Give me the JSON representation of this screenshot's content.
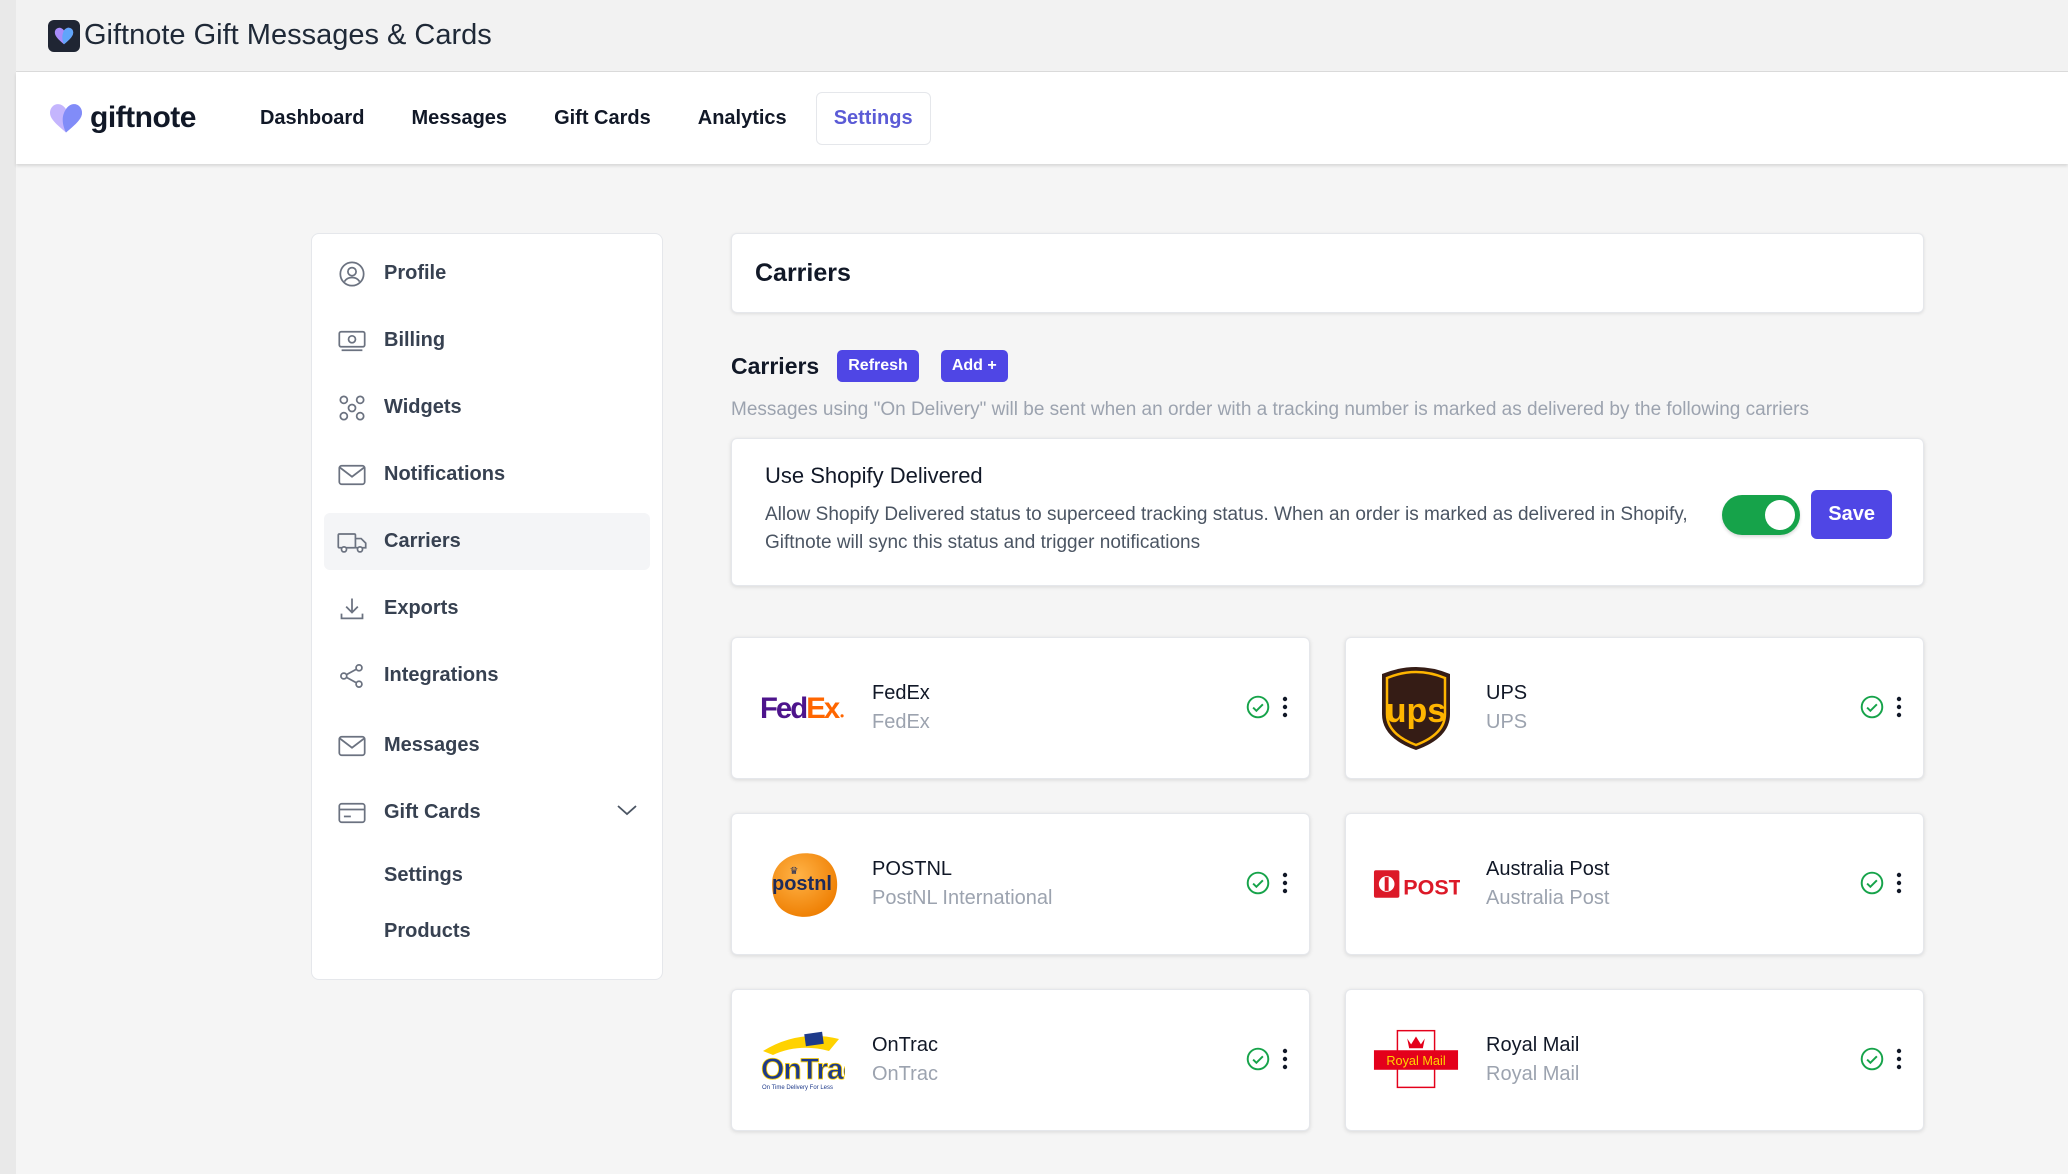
{
  "window": {
    "title": "Giftnote Gift Messages & Cards"
  },
  "brand": {
    "name": "giftnote",
    "accent": "#5b5bd6"
  },
  "nav": {
    "tabs": [
      {
        "label": "Dashboard"
      },
      {
        "label": "Messages"
      },
      {
        "label": "Gift Cards"
      },
      {
        "label": "Analytics"
      },
      {
        "label": "Settings",
        "active": true
      }
    ]
  },
  "sidebar": {
    "items": [
      {
        "label": "Profile",
        "icon": "user-circle-icon"
      },
      {
        "label": "Billing",
        "icon": "money-bill-icon"
      },
      {
        "label": "Widgets",
        "icon": "widgets-icon"
      },
      {
        "label": "Notifications",
        "icon": "envelope-icon"
      },
      {
        "label": "Carriers",
        "icon": "truck-icon",
        "active": true
      },
      {
        "label": "Exports",
        "icon": "download-icon"
      },
      {
        "label": "Integrations",
        "icon": "share-icon"
      },
      {
        "label": "Messages",
        "icon": "envelope-icon"
      },
      {
        "label": "Gift Cards",
        "icon": "credit-card-icon",
        "expanded": true
      }
    ],
    "gift_cards_sub": [
      {
        "label": "Settings"
      },
      {
        "label": "Products"
      }
    ]
  },
  "main": {
    "header_title": "Carriers",
    "section_title": "Carriers",
    "refresh_label": "Refresh",
    "add_label": "Add +",
    "description": "Messages using \"On Delivery\" will be sent when an order with a tracking number is marked as delivered by the following carriers",
    "shopify": {
      "title": "Use Shopify Delivered",
      "description": "Allow Shopify Delivered status to superceed tracking status. When an order is marked as delivered in Shopify, Giftnote will sync this status and trigger notifications",
      "enabled": true,
      "save_label": "Save"
    },
    "carriers": [
      {
        "name": "FedEx",
        "sub": "FedEx",
        "logo": "fedex-logo",
        "logo_text": "FedEx",
        "active": true
      },
      {
        "name": "UPS",
        "sub": "UPS",
        "logo": "ups-logo",
        "logo_text": "ups",
        "active": true
      },
      {
        "name": "POSTNL",
        "sub": "PostNL International",
        "logo": "postnl-logo",
        "logo_text": "postnl",
        "active": true
      },
      {
        "name": "Australia Post",
        "sub": "Australia Post",
        "logo": "australia-post-logo",
        "logo_text": "POST",
        "active": true
      },
      {
        "name": "OnTrac",
        "sub": "OnTrac",
        "logo": "ontrac-logo",
        "logo_text": "OnTrac",
        "logo_tagline": "On Time Delivery For Less",
        "active": true
      },
      {
        "name": "Royal Mail",
        "sub": "Royal Mail",
        "logo": "royal-mail-logo",
        "logo_text": "Royal Mail",
        "active": true
      }
    ]
  },
  "colors": {
    "primary": "#4f46e5",
    "success": "#16a34a",
    "muted": "#9ca3af"
  }
}
